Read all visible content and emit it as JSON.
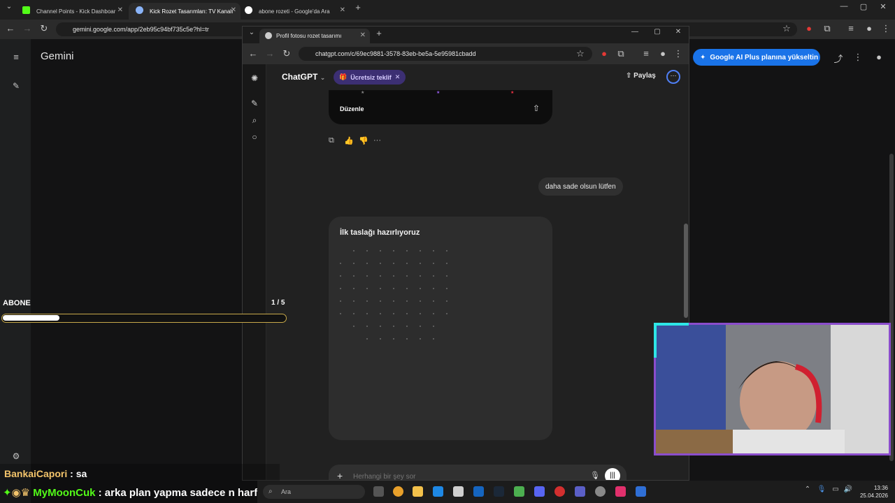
{
  "back_browser": {
    "tabs": [
      {
        "label": "Channel Points - Kick Dashboar",
        "favicon_color": "#53fc18"
      },
      {
        "label": "Kick Rozet Tasarımları: TV Kanalı",
        "favicon_color": "#8ab4f8"
      },
      {
        "label": "abone rozeti - Google'da Ara",
        "favicon_color": "#ffffff"
      }
    ],
    "url": "gemini.google.com/app/2eb95c94bf735c5e?hl=tr",
    "app_title": "Gemini",
    "upgrade_button": "Google AI Plus planına yükseltin"
  },
  "front_window": {
    "tab_title": "Profil fotosu rozet tasarımı",
    "url": "chatgpt.com/c/69ec9881-3578-83eb-be5a-5e95981cbadd",
    "model": "ChatGPT",
    "offer_chip": "Ücretsiz teklif",
    "share_label": "Paylaş",
    "image_card_edit": "Düzenle",
    "user_message": "daha sade olsun lütfen",
    "draft_title": "İlk taslağı hazırlıyoruz",
    "composer_placeholder": "Herhangi bir şey sor"
  },
  "overlay": {
    "goal_label": "ABONE",
    "goal_count": "1 / 5",
    "goal_progress": 0.2,
    "chat": [
      {
        "user": "BankaiCapori",
        "text": " : sa"
      },
      {
        "user": "MyMoonCuk",
        "text": " : arka plan yapma sadece n harfi"
      }
    ]
  },
  "taskbar": {
    "search_placeholder": "Ara",
    "time": "13:36",
    "date": "25.04.2026"
  },
  "colors": {
    "accent_blue": "#1a73e8",
    "offer_purple": "#3c2f73",
    "kick_green": "#53fc18",
    "webcam_border": "#8b4dcc"
  }
}
